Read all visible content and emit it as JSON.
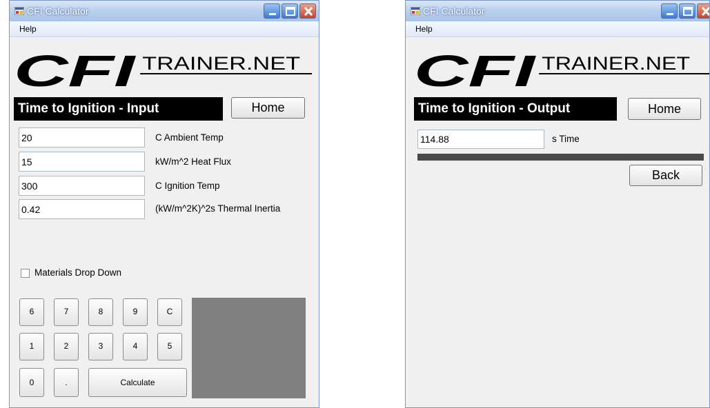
{
  "left": {
    "title": "CFI Calculator",
    "menu_help": "Help",
    "logo_big": "CFI",
    "logo_site": "TRAINER.NET",
    "header": "Time to Ignition - Input",
    "home_button": "Home",
    "fields": [
      {
        "value": "20",
        "label": "C Ambient Temp"
      },
      {
        "value": "15",
        "label": "kW/m^2 Heat Flux"
      },
      {
        "value": "300",
        "label": "C Ignition Temp"
      },
      {
        "value": "0.42",
        "label": "(kW/m^2K)^2s Thermal Inertia"
      }
    ],
    "checkbox_label": "Materials Drop Down",
    "keypad": [
      "6",
      "7",
      "8",
      "9",
      "C",
      "1",
      "2",
      "3",
      "4",
      "5",
      "0",
      "."
    ],
    "calculate_button": "Calculate"
  },
  "right": {
    "title": "CFI Calculator",
    "menu_help": "Help",
    "logo_big": "CFI",
    "logo_site": "TRAINER.NET",
    "header": "Time to Ignition - Output",
    "home_button": "Home",
    "output_value": "114.88",
    "output_label": "s Time",
    "back_button": "Back"
  }
}
